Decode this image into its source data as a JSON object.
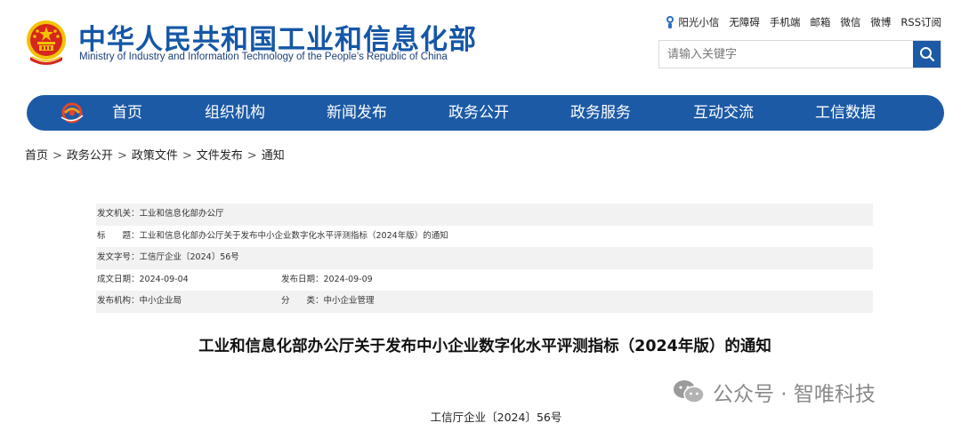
{
  "header": {
    "site_title": "中华人民共和国工业和信息化部",
    "site_subtitle": "Ministry of Industry and Information Technology of the People’s Republic of China",
    "top_links": [
      "阳光小信",
      "无障碍",
      "手机端",
      "邮箱",
      "微信",
      "微博",
      "RSS订阅"
    ],
    "search_placeholder": "请输入关键字"
  },
  "nav": {
    "items": [
      "首页",
      "组织机构",
      "新闻发布",
      "政务公开",
      "政务服务",
      "互动交流",
      "工信数据"
    ]
  },
  "breadcrumb": [
    "首页",
    "政务公开",
    "政策文件",
    "文件发布",
    "通知"
  ],
  "info": {
    "issuer_label": "发文机关：",
    "issuer": "工业和信息化部办公厅",
    "title_label": "标　　题：",
    "title": "工业和信息化部办公厅关于发布中小企业数字化水平评测指标（2024年版）的通知",
    "doc_no_label": "发文字号：",
    "doc_no": "工信厅企业〔2024〕56号",
    "date_label": "成文日期：",
    "date": "2024-09-04",
    "publish_label": "发布日期：",
    "publish": "2024-09-09",
    "org_label": "发布机构：",
    "org": "中小企业局",
    "category_label": "分　　类：",
    "category": "中小企业管理"
  },
  "document": {
    "title": "工业和信息化部办公厅关于发布中小企业数字化水平评测指标（2024年版）的通知",
    "number": "工信厅企业〔2024〕56号"
  },
  "watermark": "公众号 · 智唯科技",
  "colors": {
    "brand_blue": "#1c5aa6",
    "title_blue": "#1557a7",
    "row_shade": "#f2f2f2",
    "emblem_red": "#d7261e",
    "emblem_gold": "#f2c200"
  },
  "icons": {
    "emblem": "national-emblem-icon",
    "sun": "sunshine-mascot-icon",
    "search": "search-icon",
    "nav_logo": "ministry-logo-icon",
    "watermark": "wechat-icon"
  }
}
